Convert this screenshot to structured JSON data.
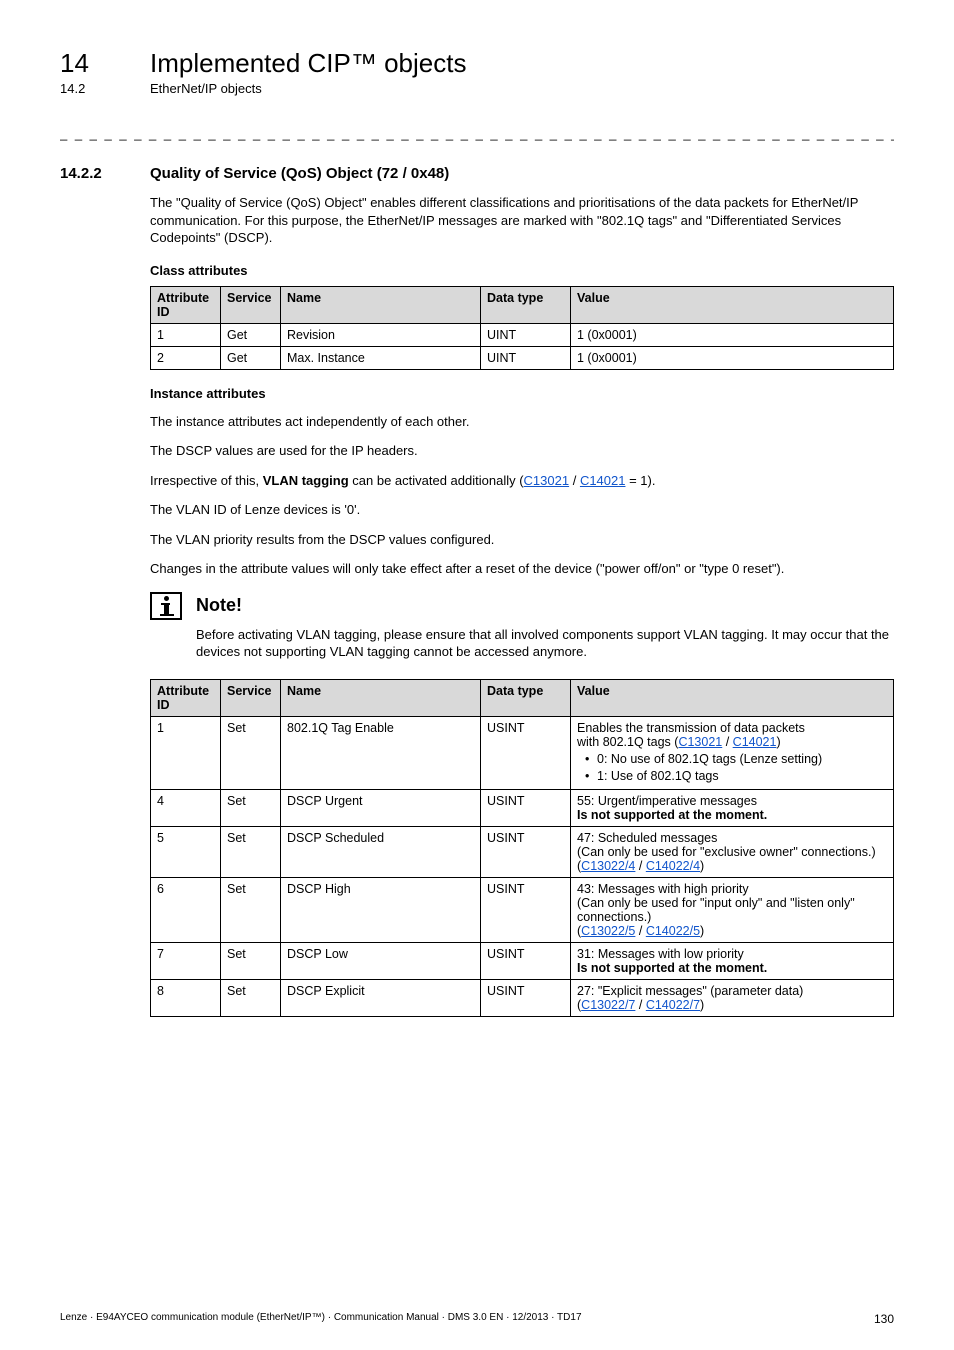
{
  "header": {
    "chapter_number": "14",
    "chapter_title": "Implemented CIP™ objects",
    "section_number": "14.2",
    "section_title": "EtherNet/IP objects"
  },
  "separator": "_ _ _ _ _ _ _ _ _ _ _ _ _ _ _ _ _ _ _ _ _ _ _ _ _ _ _ _ _ _ _ _ _ _ _ _ _ _ _ _ _ _ _ _ _ _ _ _ _ _ _ _ _ _ _ _ _ _ _ _ _ _ _ _",
  "section": {
    "number": "14.2.2",
    "title": "Quality of Service (QoS) Object (72 / 0x48)",
    "intro": "The \"Quality of Service (QoS) Object\" enables different classifications and prioritisations of the data packets for EtherNet/IP communication. For this purpose, the EtherNet/IP messages are marked with \"802.1Q tags\" and \"Differentiated Services Codepoints\" (DSCP)."
  },
  "class_attr": {
    "heading": "Class attributes",
    "headers": [
      "Attribute ID",
      "Service",
      "Name",
      "Data type",
      "Value"
    ],
    "rows": [
      [
        "1",
        "Get",
        "Revision",
        "UINT",
        "1 (0x0001)"
      ],
      [
        "2",
        "Get",
        "Max. Instance",
        "UINT",
        "1 (0x0001)"
      ]
    ]
  },
  "instance_text": {
    "heading": "Instance attributes",
    "p1": "The instance attributes act independently of each other.",
    "p2": "The DSCP values are used for the IP headers.",
    "p3_pre": "Irrespective of this, ",
    "p3_bold": "VLAN tagging",
    "p3_mid": " can be activated additionally (",
    "p3_link1": "C13021",
    "p3_slash": " / ",
    "p3_link2": "C14021",
    "p3_post": " = 1).",
    "p4": "The VLAN ID of Lenze devices is '0'.",
    "p5": "The VLAN priority results from the DSCP values configured.",
    "p6": "Changes in the attribute values will only take effect after a reset of the device (\"power off/on\" or \"type 0 reset\")."
  },
  "note": {
    "title": "Note!",
    "body": "Before activating VLAN tagging, please ensure that all involved components support VLAN tagging. It may occur that the devices not supporting VLAN tagging cannot be accessed anymore."
  },
  "inst_table": {
    "headers": [
      "Attribute ID",
      "Service",
      "Name",
      "Data type",
      "Value"
    ],
    "rows": [
      {
        "id": "1",
        "service": "Set",
        "name": "802.1Q Tag Enable",
        "dtype": "USINT",
        "value_plain": "Enables the transmission of data packets",
        "value_line2_pre": "with 802.1Q tags (",
        "value_line2_l1": "C13021",
        "value_line2_sep": " / ",
        "value_line2_l2": "C14021",
        "value_line2_post": ")",
        "bullets": [
          "0: No use of 802.1Q tags (Lenze setting)",
          "1: Use of 802.1Q tags"
        ]
      },
      {
        "id": "4",
        "service": "Set",
        "name": "DSCP Urgent",
        "dtype": "USINT",
        "value_l1": "55: Urgent/imperative messages",
        "value_l2_bold": "Is not supported at the moment."
      },
      {
        "id": "5",
        "service": "Set",
        "name": "DSCP Scheduled",
        "dtype": "USINT",
        "value_l1": "47: Scheduled messages",
        "value_l2": "(Can only be used for \"exclusive owner\" connections.)",
        "value_link_pre": "(",
        "value_link_l1": "C13022/4",
        "value_link_sep": " / ",
        "value_link_l2": "C14022/4",
        "value_link_post": ")"
      },
      {
        "id": "6",
        "service": "Set",
        "name": "DSCP High",
        "dtype": "USINT",
        "value_l1": "43: Messages with high priority",
        "value_l2": "(Can only be used for \"input only\" and \"listen only\" connections.)",
        "value_link_pre": "(",
        "value_link_l1": "C13022/5",
        "value_link_sep": " / ",
        "value_link_l2": "C14022/5",
        "value_link_post": ")"
      },
      {
        "id": "7",
        "service": "Set",
        "name": "DSCP Low",
        "dtype": "USINT",
        "value_l1": "31: Messages with low priority",
        "value_l2_bold": "Is not supported at the moment."
      },
      {
        "id": "8",
        "service": "Set",
        "name": "DSCP Explicit",
        "dtype": "USINT",
        "value_l1": "27: \"Explicit messages\" (parameter data)",
        "value_link_pre": "(",
        "value_link_l1": "C13022/7",
        "value_link_sep": " / ",
        "value_link_l2": "C14022/7",
        "value_link_post": ")"
      }
    ]
  },
  "footer": {
    "left": "Lenze · E94AYCEO communication module (EtherNet/IP™) · Communication Manual · DMS 3.0 EN · 12/2013 · TD17",
    "page": "130"
  }
}
